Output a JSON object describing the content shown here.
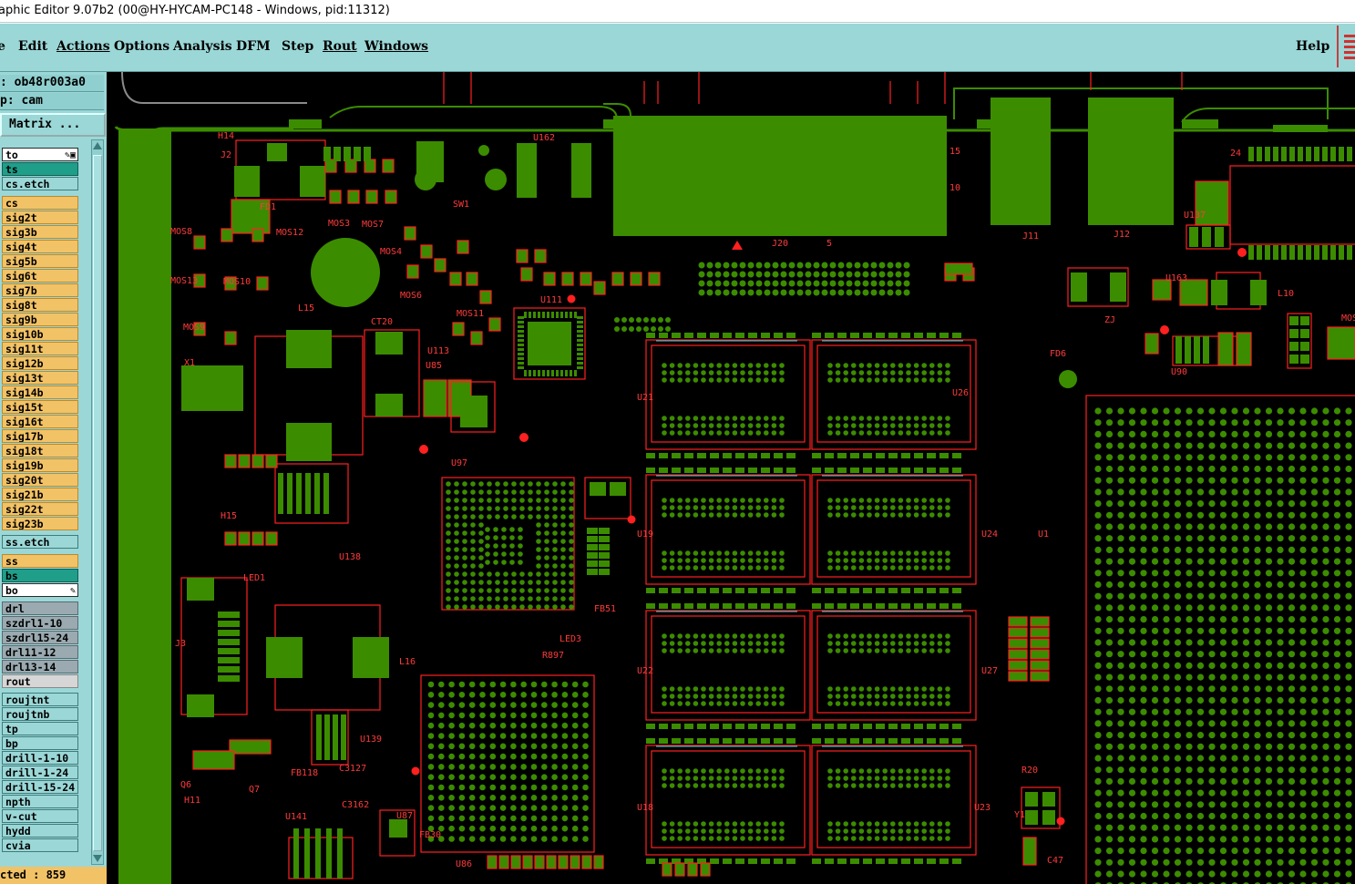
{
  "window": {
    "title": "aphic Editor 9.07b2 (00@HY-HYCAM-PC148 - Windows, pid:11312)"
  },
  "menu": {
    "items": [
      "e",
      "Edit",
      "Actions",
      "Options",
      "Analysis",
      "DFM",
      "Step",
      "Rout",
      "Windows"
    ],
    "help": "Help"
  },
  "job": {
    "job_label": ": ob48r003a0",
    "step_label": "p: cam",
    "matrix_button": "Matrix ..."
  },
  "layers": [
    {
      "name": "to",
      "style": "white",
      "icon": "edit-display-icon"
    },
    {
      "name": "ts",
      "style": "teal"
    },
    {
      "name": "cs.etch",
      "style": "cyan"
    },
    {
      "name": "cs",
      "style": "orange"
    },
    {
      "name": "sig2t",
      "style": "orange"
    },
    {
      "name": "sig3b",
      "style": "orange"
    },
    {
      "name": "sig4t",
      "style": "orange"
    },
    {
      "name": "sig5b",
      "style": "orange"
    },
    {
      "name": "sig6t",
      "style": "orange"
    },
    {
      "name": "sig7b",
      "style": "orange"
    },
    {
      "name": "sig8t",
      "style": "orange"
    },
    {
      "name": "sig9b",
      "style": "orange"
    },
    {
      "name": "sig10b",
      "style": "orange"
    },
    {
      "name": "sig11t",
      "style": "orange"
    },
    {
      "name": "sig12b",
      "style": "orange"
    },
    {
      "name": "sig13t",
      "style": "orange"
    },
    {
      "name": "sig14b",
      "style": "orange"
    },
    {
      "name": "sig15t",
      "style": "orange"
    },
    {
      "name": "sig16t",
      "style": "orange"
    },
    {
      "name": "sig17b",
      "style": "orange"
    },
    {
      "name": "sig18t",
      "style": "orange"
    },
    {
      "name": "sig19b",
      "style": "orange"
    },
    {
      "name": "sig20t",
      "style": "orange"
    },
    {
      "name": "sig21b",
      "style": "orange"
    },
    {
      "name": "sig22t",
      "style": "orange"
    },
    {
      "name": "sig23b",
      "style": "orange"
    },
    {
      "name": "ss.etch",
      "style": "cyan"
    },
    {
      "name": "ss",
      "style": "orange"
    },
    {
      "name": "bs",
      "style": "teal"
    },
    {
      "name": "bo",
      "style": "white",
      "icon": "edit-icon"
    },
    {
      "name": "drl",
      "style": "gray"
    },
    {
      "name": "szdrl1-10",
      "style": "gray"
    },
    {
      "name": "szdrl15-24",
      "style": "gray"
    },
    {
      "name": "drl11-12",
      "style": "gray"
    },
    {
      "name": "drl13-14",
      "style": "gray"
    },
    {
      "name": "rout",
      "style": "lightgray"
    },
    {
      "name": "roujtnt",
      "style": "cyan"
    },
    {
      "name": "roujtnb",
      "style": "cyan"
    },
    {
      "name": "tp",
      "style": "cyan"
    },
    {
      "name": "bp",
      "style": "cyan"
    },
    {
      "name": "drill-1-10",
      "style": "cyan"
    },
    {
      "name": "drill-1-24",
      "style": "cyan"
    },
    {
      "name": "drill-15-24",
      "style": "cyan"
    },
    {
      "name": "npth",
      "style": "cyan"
    },
    {
      "name": "v-cut",
      "style": "cyan"
    },
    {
      "name": "hydd",
      "style": "cyan"
    },
    {
      "name": "cvia",
      "style": "cyan"
    }
  ],
  "status": {
    "selected": "cted : 859"
  },
  "colors": {
    "pad": "#3c8c00",
    "outline": "#ff2020",
    "trace": "#3c8c00",
    "silk_cyan": "#4fd0e0",
    "menu_bg": "#9bd7d7",
    "layer_orange": "#f2c266",
    "layer_teal": "#1f9e8a",
    "layer_gray": "#9aaab0"
  },
  "pcb_labels": [
    {
      "text": "H14"
    },
    {
      "text": "J2"
    },
    {
      "text": "FD1"
    },
    {
      "text": "SW1"
    },
    {
      "text": "U162"
    },
    {
      "text": "MOS8"
    },
    {
      "text": "MOS12"
    },
    {
      "text": "MOS3"
    },
    {
      "text": "MOS7"
    },
    {
      "text": "MOS13"
    },
    {
      "text": "MOS10"
    },
    {
      "text": "MOS9"
    },
    {
      "text": "MOS4"
    },
    {
      "text": "MOS6"
    },
    {
      "text": "MOS11"
    },
    {
      "text": "L15"
    },
    {
      "text": "CT20"
    },
    {
      "text": "U113"
    },
    {
      "text": "U85"
    },
    {
      "text": "U111"
    },
    {
      "text": "U97"
    },
    {
      "text": "U21"
    },
    {
      "text": "U26"
    },
    {
      "text": "U19"
    },
    {
      "text": "U24"
    },
    {
      "text": "U22"
    },
    {
      "text": "U27"
    },
    {
      "text": "U18"
    },
    {
      "text": "U23"
    },
    {
      "text": "J20"
    },
    {
      "text": "J11"
    },
    {
      "text": "J12"
    },
    {
      "text": "U137"
    },
    {
      "text": "U163"
    },
    {
      "text": "L10"
    },
    {
      "text": "ZJ"
    },
    {
      "text": "U90"
    },
    {
      "text": "FD6"
    },
    {
      "text": "U1"
    },
    {
      "text": "H15"
    },
    {
      "text": "U138"
    },
    {
      "text": "LED1"
    },
    {
      "text": "J3"
    },
    {
      "text": "L16"
    },
    {
      "text": "LED3"
    },
    {
      "text": "FB51"
    },
    {
      "text": "R897"
    },
    {
      "text": "U139"
    },
    {
      "text": "FB118"
    },
    {
      "text": "C3127"
    },
    {
      "text": "C3162"
    },
    {
      "text": "U87"
    },
    {
      "text": "U141"
    },
    {
      "text": "FB30"
    },
    {
      "text": "U86"
    },
    {
      "text": "H11"
    },
    {
      "text": "Q6"
    },
    {
      "text": "Q7"
    },
    {
      "text": "R20"
    },
    {
      "text": "Y1"
    },
    {
      "text": "C47"
    },
    {
      "text": "X1"
    },
    {
      "text": "24"
    },
    {
      "text": "15"
    },
    {
      "text": "10"
    },
    {
      "text": "5"
    },
    {
      "text": "MOS"
    }
  ]
}
